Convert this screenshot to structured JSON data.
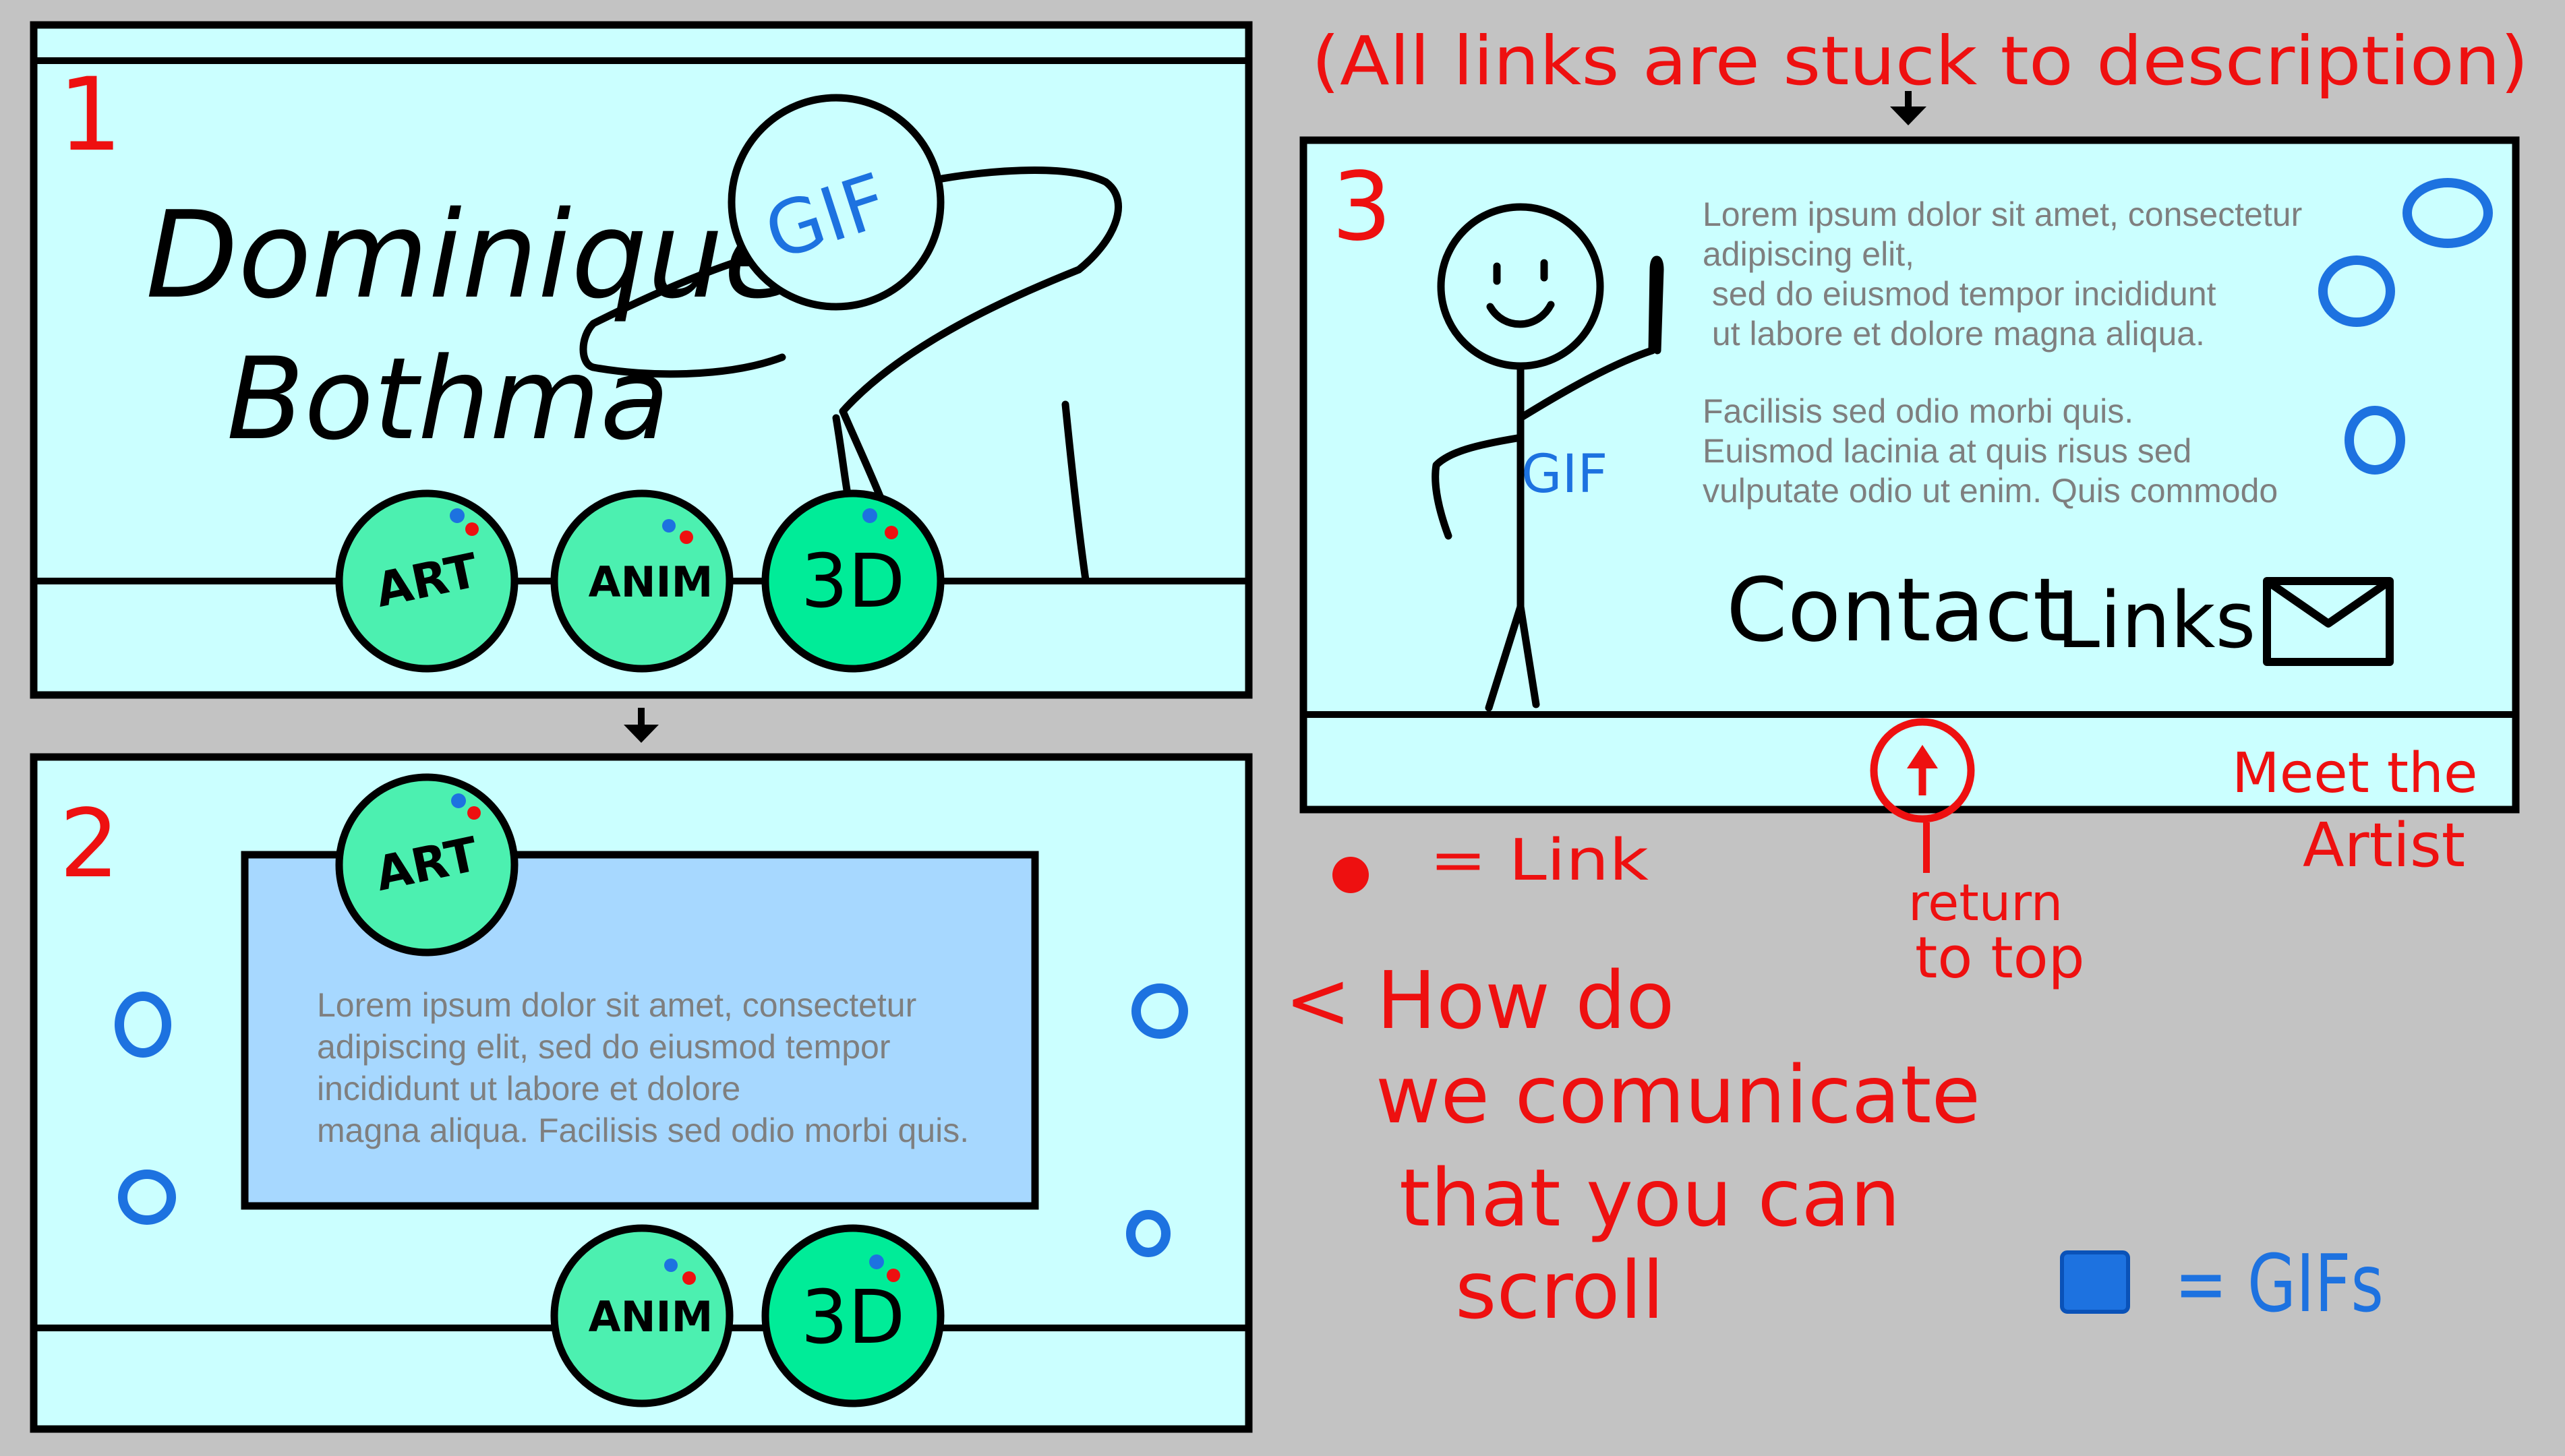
{
  "colors": {
    "background": "#c3c3c3",
    "frame_fill": "#cbffff",
    "content_box_fill": "#a7d8ff",
    "button_fill": "#4cf0b0",
    "annotation_red": "#ee1010",
    "link_blue": "#1d72e0",
    "ink": "#000000",
    "lorem_grey": "#7f7f7f"
  },
  "top_note": "(All links are stuck to description)",
  "panel1": {
    "number": "1",
    "name_line1": "Dominique",
    "name_line2": "Bothma",
    "gif_label": "GIF",
    "buttons": [
      "ART",
      "ANIM",
      "3D"
    ]
  },
  "panel2": {
    "number": "2",
    "art_button": "ART",
    "lorem_lines": [
      "Lorem ipsum dolor sit amet, consectetur",
      "adipiscing elit, sed do eiusmod tempor",
      "incididunt ut labore et dolore",
      "magna aliqua. Facilisis sed odio morbi quis."
    ],
    "buttons": [
      "ANIM",
      "3D"
    ]
  },
  "panel3": {
    "number": "3",
    "gif_label": "GIF",
    "lorem_block1": [
      "Lorem ipsum dolor sit amet, consectetur",
      "adipiscing elit,",
      " sed do eiusmod tempor incididunt",
      " ut labore et dolore magna aliqua."
    ],
    "lorem_block2": [
      "Facilisis sed odio morbi quis.",
      "Euismod lacinia at quis risus sed",
      "vulputate odio ut enim. Quis commodo"
    ],
    "contact": "Contact",
    "links": "Links"
  },
  "notes": {
    "link_legend": "= Link",
    "return_line1": "return",
    "return_line2": "to top",
    "meet_line1": "Meet the",
    "meet_line2": "Artist",
    "scroll_lines": [
      "< How do",
      "we comunicate",
      "that you can",
      "scroll"
    ],
    "gifs_legend": "= GIFs"
  }
}
